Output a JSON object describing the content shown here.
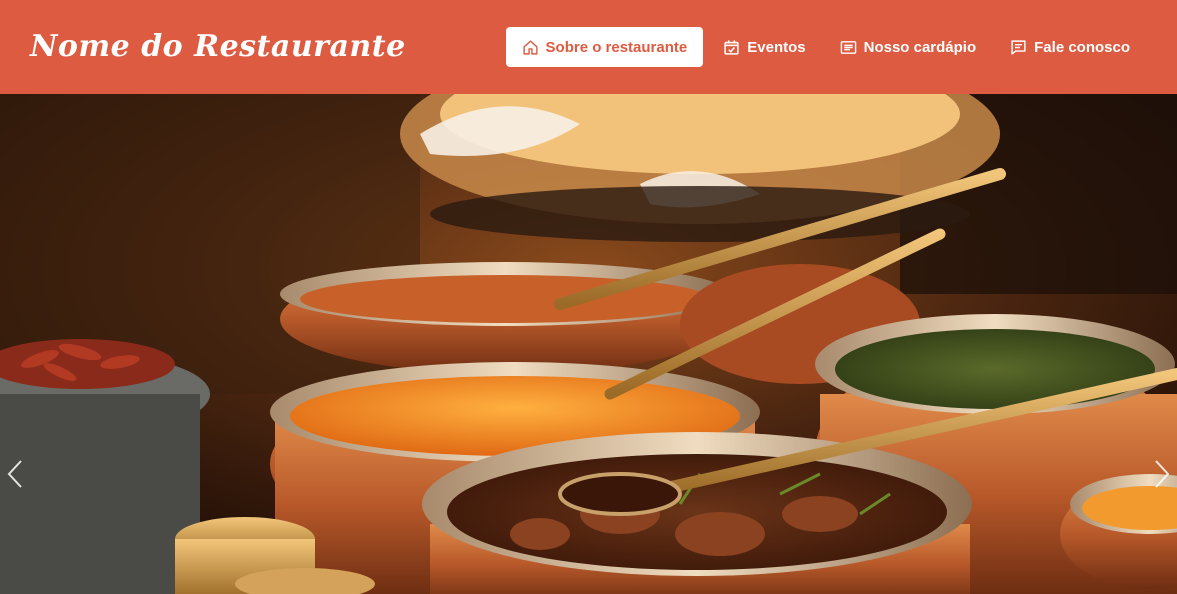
{
  "header": {
    "brand": "Nome do Restaurante",
    "nav": [
      {
        "label": "Sobre o restaurante",
        "icon": "home-icon",
        "active": true
      },
      {
        "label": "Eventos",
        "icon": "calendar-check-icon",
        "active": false
      },
      {
        "label": "Nosso cardápio",
        "icon": "menu-list-icon",
        "active": false
      },
      {
        "label": "Fale conosco",
        "icon": "chat-bubble-icon",
        "active": false
      }
    ]
  },
  "carousel": {
    "prev_icon": "chevron-left-icon",
    "next_icon": "chevron-right-icon"
  },
  "colors": {
    "header_bg": "#dd5b41",
    "header_text": "#ffffff",
    "active_text": "#dd5b41"
  }
}
